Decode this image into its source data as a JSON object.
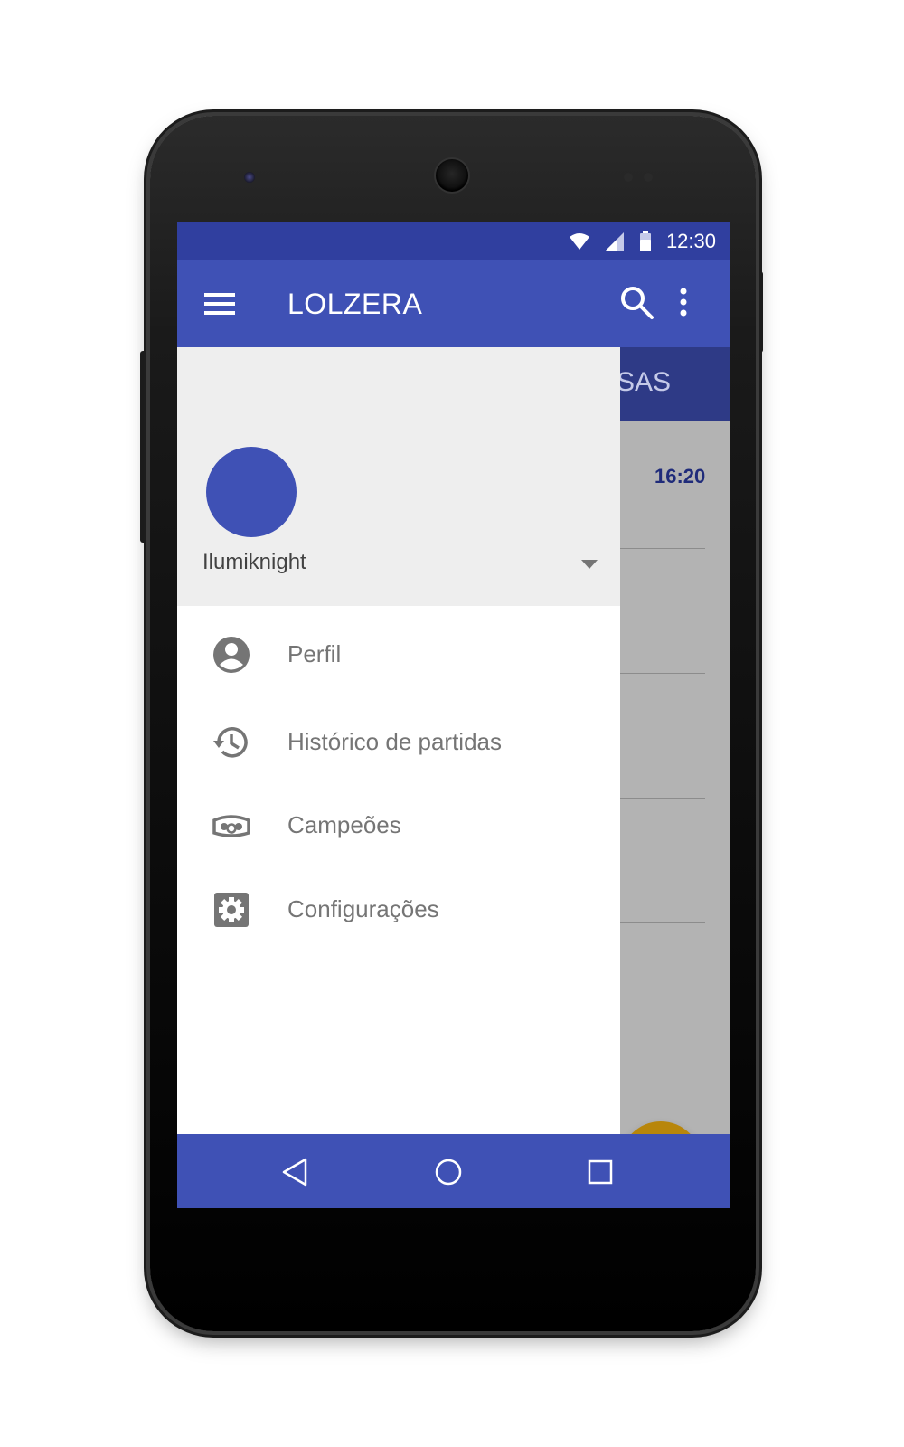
{
  "status_bar": {
    "time": "12:30"
  },
  "app_bar": {
    "title": "LOLZERA"
  },
  "background": {
    "tab_label": "SAS",
    "time": "16:20",
    "fab_symbol": "+"
  },
  "drawer": {
    "username": "Ilumiknight",
    "items": [
      {
        "label": "Perfil",
        "icon": "account-circle-icon"
      },
      {
        "label": "Histórico de partidas",
        "icon": "history-icon"
      },
      {
        "label": "Campeões",
        "icon": "champion-mask-icon"
      },
      {
        "label": "Configurações",
        "icon": "settings-icon"
      }
    ]
  },
  "colors": {
    "primary": "#3f51b5",
    "primary_dark": "#303f9f",
    "accent": "#b8860b",
    "drawer_header": "#eeeeee",
    "nav_text": "#757575"
  }
}
